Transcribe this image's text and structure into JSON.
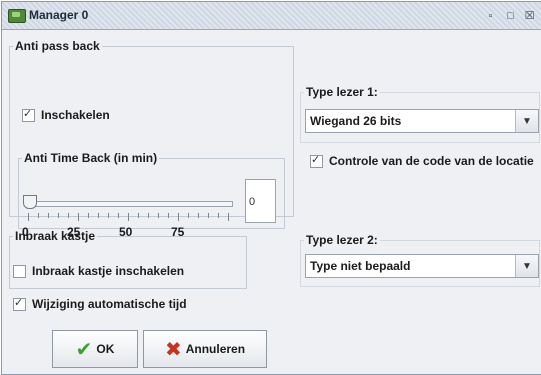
{
  "window": {
    "title": "Manager 0"
  },
  "anti_pass_back": {
    "legend": "Anti pass back",
    "enable_label": "Inschakelen",
    "enable_checked": true,
    "time_back_legend": "Anti Time Back (in min)",
    "slider_value": 0,
    "slider_ticks": [
      "0",
      "25",
      "50",
      "75"
    ],
    "numeric_value": "0"
  },
  "burglary": {
    "legend": "Inbraak kastje",
    "enable_label": "Inbraak kastje inschakelen",
    "enable_checked": false
  },
  "auto_time": {
    "label": "Wijziging automatische tijd",
    "checked": true
  },
  "reader1": {
    "legend": "Type lezer 1:",
    "selected": "Wiegand 26 bits",
    "check_label": "Controle van de code van de locatie",
    "check_checked": true
  },
  "reader2": {
    "legend": "Type lezer 2:",
    "selected": "Type niet bepaald"
  },
  "buttons": {
    "ok": "OK",
    "cancel": "Annuleren"
  },
  "colors": {
    "ok_icon": "#3aa52a",
    "cancel_icon": "#c8321e"
  }
}
